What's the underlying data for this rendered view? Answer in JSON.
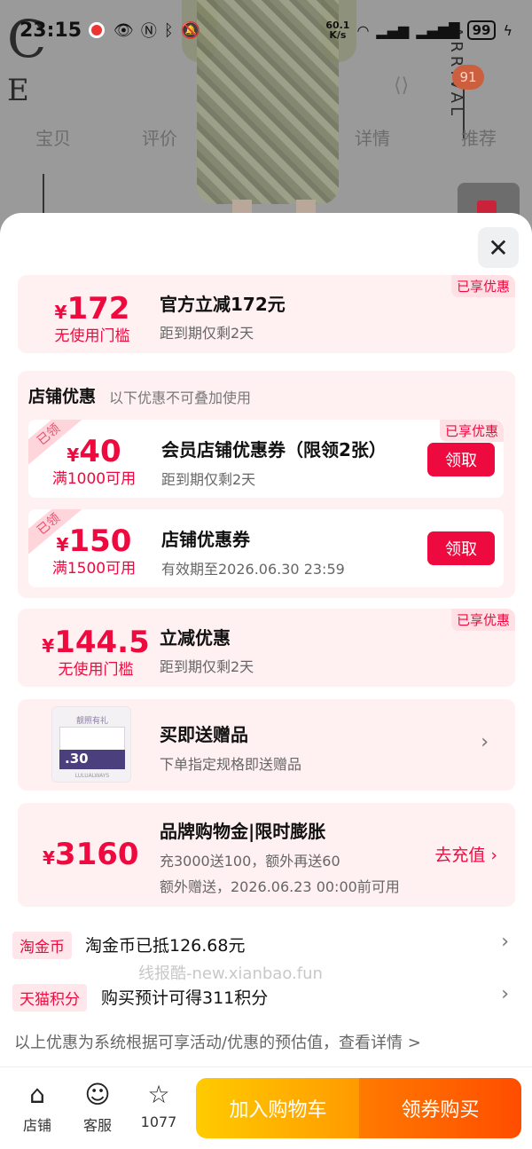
{
  "status": {
    "time": "23:15",
    "speed_top": "60.1",
    "speed_unit": "K/s",
    "battery": "99"
  },
  "backdrop": {
    "cart_badge": "91",
    "tabs": [
      "宝贝",
      "评价",
      "详情",
      "推荐"
    ]
  },
  "official": {
    "amount": "172",
    "currency": "¥",
    "condition": "无使用门槛",
    "title": "官方立减172元",
    "subtitle": "距到期仅剩2天",
    "tag": "已享优惠"
  },
  "store": {
    "title": "店铺优惠",
    "note": "以下优惠不可叠加使用",
    "coupons": [
      {
        "corner": "已领",
        "amount": "40",
        "condition": "满1000可用",
        "title": "会员店铺优惠券（限领2张）",
        "subtitle": "距到期仅剩2天",
        "tag": "已享优惠",
        "button": "领取"
      },
      {
        "corner": "已领",
        "amount": "150",
        "condition": "满1500可用",
        "title": "店铺优惠券",
        "subtitle": "有效期至2026.06.30 23:59",
        "button": "领取"
      }
    ]
  },
  "instant": {
    "amount": "144.5",
    "condition": "无使用门槛",
    "title": "立减优惠",
    "subtitle": "距到期仅剩2天",
    "tag": "已享优惠"
  },
  "gift": {
    "title": "买即送赠品",
    "subtitle": "下单指定规格即送赠品",
    "thumb_title": "靓照有礼",
    "thumb_num": ".30",
    "thumb_brand": "LULUALWAYS"
  },
  "brand_gold": {
    "amount": "3160",
    "title": "品牌购物金|限时膨胀",
    "line1": "充3000送100，额外再送60",
    "line2": "额外赠送，2026.06.23 00:00前可用",
    "action": "去充值"
  },
  "taojinbi": {
    "tag": "淘金币",
    "text": "淘金币已抵126.68元"
  },
  "tmall_points": {
    "tag": "天猫积分",
    "text": "购买预计可得311积分"
  },
  "watermark": "线报酷-new.xianbao.fun",
  "footnote": "以上优惠为系统根据可享活动/优惠的预估值，查看详情 >",
  "bottom": {
    "store_label": "店铺",
    "service_label": "客服",
    "fav_count": "1077",
    "cart_button": "加入购物车",
    "buy_button": "领券购买"
  }
}
